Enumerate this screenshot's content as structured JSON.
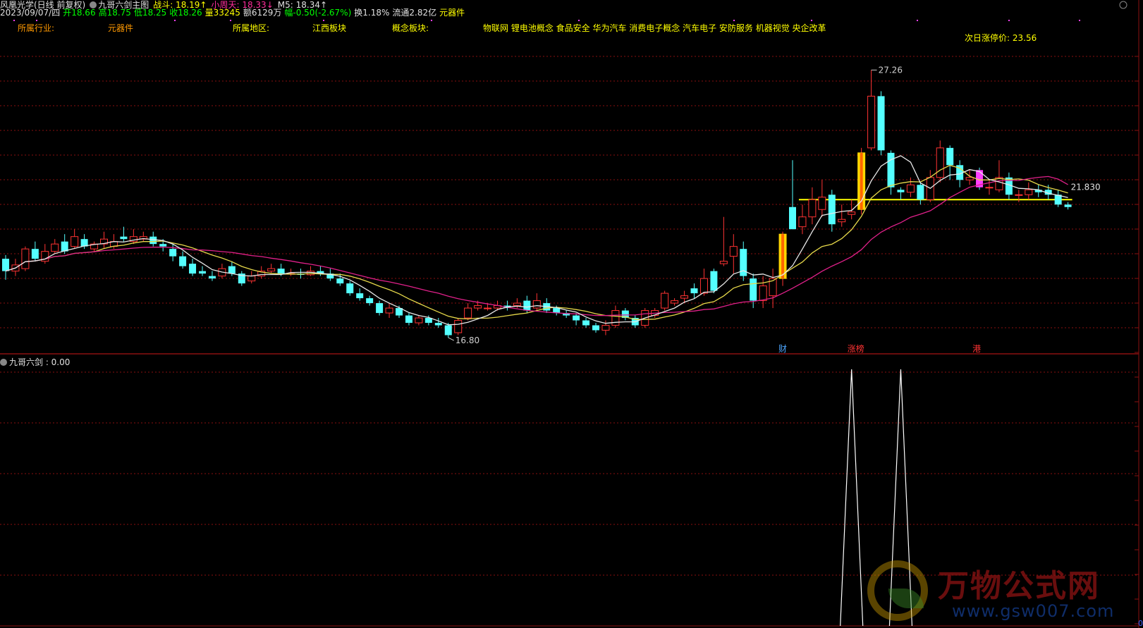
{
  "header": {
    "row1": [
      {
        "text": "风凰光学(日线 前复权)",
        "color": "white"
      },
      {
        "text": "九哥六剑主图",
        "color": "white",
        "icon": "circle-icon"
      },
      {
        "text": "战斗: 18.19↑",
        "color": "yellow"
      },
      {
        "text": "小周天: 18.33↓",
        "color": "magenta"
      },
      {
        "text": "M5: 18.34↑",
        "color": "white"
      }
    ],
    "row2": [
      {
        "text": "2023/09/07/四",
        "color": "white"
      },
      {
        "text": "开18.66",
        "color": "green"
      },
      {
        "text": "高18.75",
        "color": "green"
      },
      {
        "text": "低18.25",
        "color": "green"
      },
      {
        "text": "收18.26",
        "color": "green"
      },
      {
        "text": "量33245",
        "color": "yellow"
      },
      {
        "text": "额6129万",
        "color": "white"
      },
      {
        "text": "幅-0.50(-2.67%)",
        "color": "green"
      },
      {
        "text": "换1.18%",
        "color": "white"
      },
      {
        "text": "流通2.82亿",
        "color": "white"
      },
      {
        "text": "元器件",
        "color": "yellow"
      }
    ],
    "row3": [
      {
        "text": "所属行业:",
        "color": "orange",
        "x": 25
      },
      {
        "text": "元器件",
        "color": "orange",
        "x": 153
      },
      {
        "text": "所属地区:",
        "color": "yellow",
        "x": 330
      },
      {
        "text": "江西板块",
        "color": "yellow",
        "x": 443
      },
      {
        "text": "概念板块:",
        "color": "yellow",
        "x": 556
      },
      {
        "text": "物联网 锂电池概念 食品安全 华为汽车 消费电子概念 汽车电子 安防服务 机器视觉 央企改革",
        "color": "yellow",
        "x": 685
      }
    ],
    "limit_label": "次日涨停价: 23.56"
  },
  "sub_panel": {
    "title": "九哥六剑 : 0.00",
    "zero_label": "0"
  },
  "annotations": {
    "high_label": "27.26",
    "low_label": "16.80",
    "price_label": "21.830",
    "markers": [
      {
        "text": "财",
        "color": "#4da6ff"
      },
      {
        "text": "涨榜",
        "color": "#ff3333"
      },
      {
        "text": "港",
        "color": "#ff3333"
      }
    ]
  },
  "watermark": {
    "cn": "万物公式网",
    "url": "www.gsw007.com"
  },
  "colors": {
    "up": "#ff3333",
    "down": "#54ffff",
    "ma_white": "#e8e8e8",
    "ma_yellow": "#e6d84a",
    "ma_magenta": "#e0208a",
    "grid": "#8a1010",
    "limit_line": "#ffff00",
    "volume_up_highlight": "#ffd700",
    "signal_line": "#ffffff"
  },
  "chart_data": {
    "type": "candlestick",
    "ylim": [
      15.8,
      28.5
    ],
    "candles": [
      [
        19.6,
        19.1,
        19.75,
        18.75
      ],
      [
        19.1,
        19.35,
        19.6,
        18.9
      ],
      [
        19.2,
        20.0,
        20.1,
        19.1
      ],
      [
        20.0,
        19.6,
        20.3,
        19.5
      ],
      [
        19.5,
        19.9,
        20.2,
        19.4
      ],
      [
        19.9,
        20.2,
        20.4,
        19.8
      ],
      [
        20.3,
        19.9,
        20.6,
        19.8
      ],
      [
        20.1,
        20.5,
        20.8,
        20.0
      ],
      [
        20.4,
        20.1,
        20.6,
        20.0
      ],
      [
        20.0,
        20.2,
        20.3,
        19.9
      ],
      [
        20.2,
        20.4,
        20.7,
        20.0
      ],
      [
        20.1,
        20.3,
        20.6,
        20.0
      ],
      [
        20.5,
        20.4,
        20.9,
        20.3
      ],
      [
        20.3,
        20.5,
        20.8,
        20.2
      ],
      [
        20.4,
        20.5,
        20.7,
        20.3
      ],
      [
        20.5,
        20.2,
        20.7,
        20.1
      ],
      [
        20.2,
        20.1,
        20.4,
        19.9
      ],
      [
        20.0,
        19.7,
        20.2,
        19.5
      ],
      [
        19.7,
        19.3,
        19.9,
        19.2
      ],
      [
        19.4,
        19.0,
        19.6,
        18.9
      ],
      [
        19.1,
        19.0,
        19.3,
        18.9
      ],
      [
        18.9,
        18.8,
        19.1,
        18.7
      ],
      [
        18.9,
        19.2,
        19.4,
        18.8
      ],
      [
        19.3,
        19.0,
        19.5,
        18.9
      ],
      [
        19.0,
        18.6,
        19.1,
        18.5
      ],
      [
        18.7,
        18.9,
        19.1,
        18.6
      ],
      [
        18.9,
        19.1,
        19.3,
        18.8
      ],
      [
        19.1,
        19.2,
        19.4,
        19.0
      ],
      [
        19.2,
        19.0,
        19.4,
        18.9
      ],
      [
        19.0,
        19.0,
        19.2,
        18.9
      ],
      [
        19.0,
        18.95,
        19.2,
        18.8
      ],
      [
        18.95,
        19.1,
        19.3,
        18.9
      ],
      [
        19.1,
        19.0,
        19.3,
        18.9
      ],
      [
        19.0,
        18.8,
        19.2,
        18.7
      ],
      [
        18.8,
        18.6,
        19.0,
        18.5
      ],
      [
        18.6,
        18.2,
        18.7,
        18.1
      ],
      [
        18.2,
        18.0,
        18.4,
        17.9
      ],
      [
        18.0,
        17.8,
        18.1,
        17.7
      ],
      [
        17.8,
        17.4,
        17.9,
        17.3
      ],
      [
        17.4,
        17.6,
        17.8,
        17.2
      ],
      [
        17.6,
        17.3,
        17.7,
        17.2
      ],
      [
        17.3,
        17.0,
        17.4,
        16.9
      ],
      [
        17.0,
        17.2,
        17.3,
        16.9
      ],
      [
        17.2,
        17.0,
        17.3,
        16.9
      ],
      [
        17.0,
        16.9,
        17.2,
        16.8
      ],
      [
        16.9,
        16.5,
        17.0,
        16.4
      ],
      [
        16.6,
        17.1,
        17.2,
        16.5
      ],
      [
        17.2,
        17.6,
        17.8,
        17.1
      ],
      [
        17.6,
        17.7,
        17.9,
        17.5
      ],
      [
        17.6,
        17.6,
        17.8,
        17.5
      ],
      [
        17.6,
        17.7,
        17.9,
        17.5
      ],
      [
        17.7,
        17.6,
        17.9,
        17.5
      ],
      [
        17.7,
        17.8,
        18.0,
        17.6
      ],
      [
        17.9,
        17.5,
        18.1,
        17.4
      ],
      [
        17.6,
        17.9,
        18.2,
        17.5
      ],
      [
        17.8,
        17.5,
        18.0,
        17.4
      ],
      [
        17.6,
        17.4,
        17.7,
        17.3
      ],
      [
        17.4,
        17.3,
        17.5,
        17.2
      ],
      [
        17.3,
        17.1,
        17.4,
        16.9
      ],
      [
        17.1,
        16.9,
        17.2,
        16.8
      ],
      [
        16.9,
        16.7,
        17.0,
        16.6
      ],
      [
        16.7,
        16.9,
        17.1,
        16.5
      ],
      [
        16.9,
        17.5,
        17.7,
        16.8
      ],
      [
        17.5,
        17.2,
        17.6,
        17.1
      ],
      [
        17.2,
        16.9,
        17.3,
        16.8
      ],
      [
        16.9,
        17.5,
        17.6,
        16.8
      ],
      [
        17.3,
        17.5,
        17.6,
        17.2
      ],
      [
        17.6,
        18.2,
        18.3,
        17.5
      ],
      [
        17.8,
        17.9,
        18.0,
        17.7
      ],
      [
        18.0,
        18.1,
        18.3,
        17.8
      ],
      [
        18.4,
        18.2,
        18.6,
        18.0
      ],
      [
        18.2,
        18.8,
        19.2,
        18.1
      ],
      [
        19.1,
        18.3,
        19.2,
        18.2
      ],
      [
        19.4,
        19.5,
        21.3,
        19.3
      ],
      [
        19.7,
        20.1,
        20.6,
        19.0
      ],
      [
        20.0,
        18.9,
        20.3,
        18.7
      ],
      [
        18.8,
        17.9,
        19.0,
        17.6
      ],
      [
        17.9,
        18.5,
        18.9,
        17.6
      ],
      [
        18.1,
        18.8,
        19.2,
        17.6
      ],
      [
        18.8,
        20.6,
        20.7,
        18.5
      ],
      [
        21.7,
        20.8,
        23.6,
        20.8
      ],
      [
        20.9,
        21.3,
        21.8,
        20.6
      ],
      [
        21.3,
        22.0,
        22.5,
        21.0
      ],
      [
        21.6,
        22.1,
        22.8,
        21.3
      ],
      [
        22.2,
        21.0,
        22.4,
        20.7
      ],
      [
        21.1,
        21.2,
        21.8,
        20.9
      ],
      [
        21.4,
        21.5,
        22.0,
        21.2
      ],
      [
        21.6,
        23.9,
        24.1,
        21.4
      ],
      [
        24.1,
        26.2,
        27.26,
        24.0
      ],
      [
        26.2,
        24.0,
        26.4,
        23.8
      ],
      [
        23.9,
        22.5,
        24.0,
        22.2
      ],
      [
        22.4,
        22.3,
        22.5,
        22.0
      ],
      [
        22.3,
        22.6,
        22.9,
        22.1
      ],
      [
        22.6,
        22.0,
        22.7,
        21.8
      ],
      [
        22.0,
        22.9,
        23.2,
        21.9
      ],
      [
        22.9,
        24.1,
        24.4,
        22.7
      ],
      [
        24.1,
        23.4,
        24.2,
        22.8
      ],
      [
        23.4,
        22.8,
        23.6,
        22.5
      ],
      [
        22.8,
        22.9,
        23.2,
        22.6
      ],
      [
        23.2,
        22.5,
        23.3,
        22.4
      ],
      [
        22.5,
        22.5,
        22.8,
        22.2
      ],
      [
        22.4,
        22.9,
        23.6,
        22.3
      ],
      [
        22.9,
        22.2,
        23.1,
        22.0
      ],
      [
        22.2,
        22.2,
        22.4,
        21.9
      ],
      [
        22.2,
        22.4,
        22.7,
        22.0
      ],
      [
        22.4,
        22.3,
        22.6,
        22.1
      ],
      [
        22.4,
        22.2,
        22.6,
        22.0
      ],
      [
        22.2,
        21.8,
        22.4,
        21.7
      ],
      [
        21.8,
        21.7,
        21.9,
        21.6
      ]
    ],
    "signal": {
      "type": "spike_line",
      "spikes": [
        {
          "index": 86
        },
        {
          "index": 91
        }
      ],
      "value_label": "0.00"
    }
  }
}
